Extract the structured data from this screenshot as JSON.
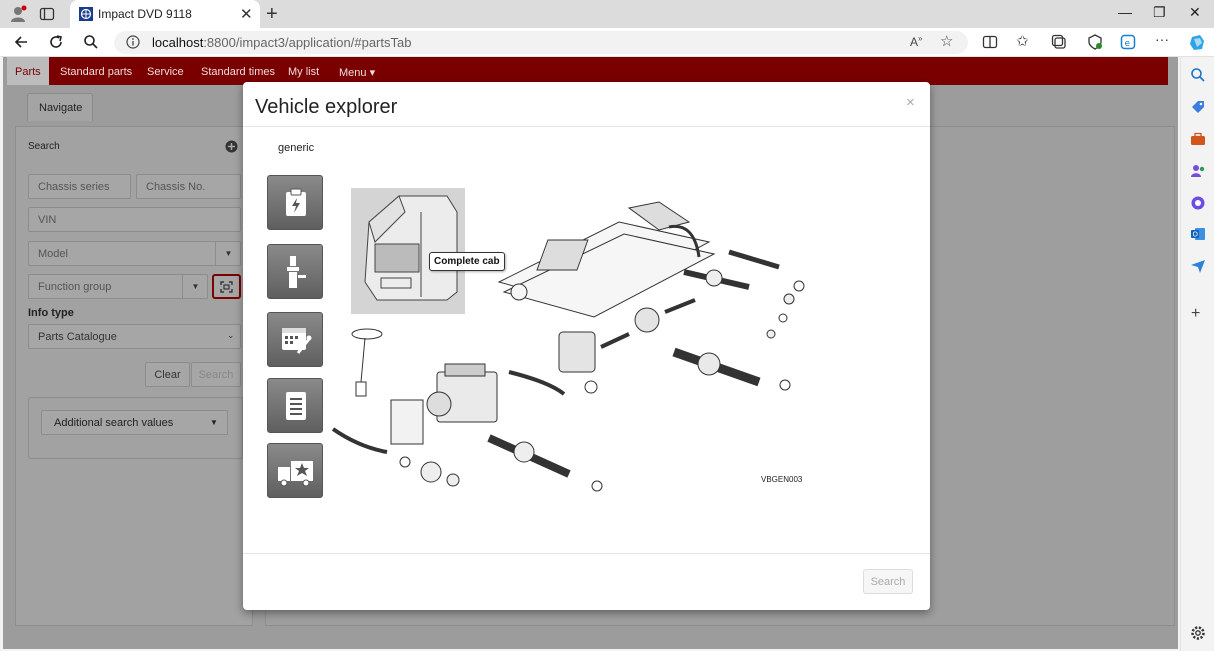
{
  "browser": {
    "tab_title": "Impact DVD 9118",
    "url_host": "localhost",
    "url_rest": ":8800/impact3/application/#partsTab"
  },
  "app_nav": {
    "items": [
      "Parts",
      "Standard parts",
      "Service",
      "Standard times",
      "My list",
      "Menu ▾"
    ]
  },
  "left": {
    "tab": "Navigate",
    "search_label": "Search",
    "chassis_series": "Chassis series",
    "chassis_no": "Chassis No.",
    "vin": "VIN",
    "model": "Model",
    "function_group": "Function group",
    "info_type_label": "Info type",
    "info_type_value": "Parts Catalogue",
    "clear": "Clear",
    "search": "Search",
    "additional": "Additional search values"
  },
  "modal": {
    "title": "Vehicle explorer",
    "close": "×",
    "generic": "generic",
    "tooltip": "Complete cab",
    "diagram_code": "VBGEN003",
    "search_button": "Search"
  }
}
